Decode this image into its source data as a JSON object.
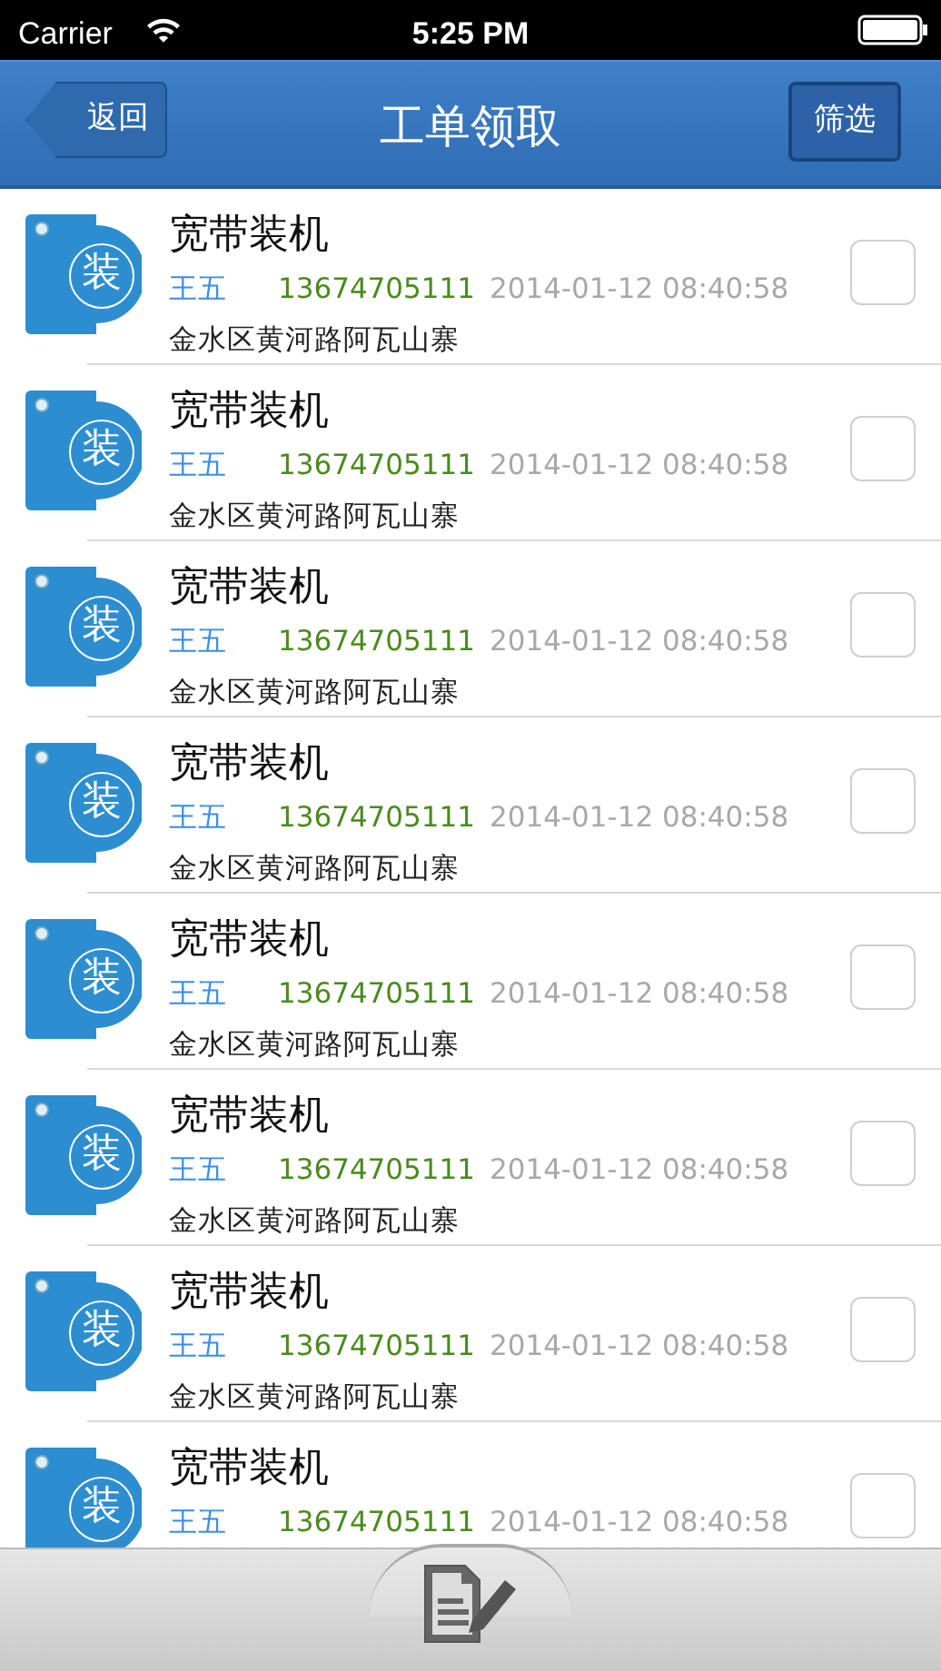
{
  "status_bar": {
    "carrier": "Carrier",
    "time": "5:25 PM"
  },
  "nav": {
    "back": "返回",
    "title": "工单领取",
    "filter": "筛选"
  },
  "orders": [
    {
      "badge": "装",
      "title": "宽带装机",
      "name": "王五",
      "phone": "13674705111",
      "time": "2014-01-12 08:40:58",
      "address": "金水区黄河路阿瓦山寨",
      "checked": false
    },
    {
      "badge": "装",
      "title": "宽带装机",
      "name": "王五",
      "phone": "13674705111",
      "time": "2014-01-12 08:40:58",
      "address": "金水区黄河路阿瓦山寨",
      "checked": false
    },
    {
      "badge": "装",
      "title": "宽带装机",
      "name": "王五",
      "phone": "13674705111",
      "time": "2014-01-12 08:40:58",
      "address": "金水区黄河路阿瓦山寨",
      "checked": false
    },
    {
      "badge": "装",
      "title": "宽带装机",
      "name": "王五",
      "phone": "13674705111",
      "time": "2014-01-12 08:40:58",
      "address": "金水区黄河路阿瓦山寨",
      "checked": false
    },
    {
      "badge": "装",
      "title": "宽带装机",
      "name": "王五",
      "phone": "13674705111",
      "time": "2014-01-12 08:40:58",
      "address": "金水区黄河路阿瓦山寨",
      "checked": false
    },
    {
      "badge": "装",
      "title": "宽带装机",
      "name": "王五",
      "phone": "13674705111",
      "time": "2014-01-12 08:40:58",
      "address": "金水区黄河路阿瓦山寨",
      "checked": false
    },
    {
      "badge": "装",
      "title": "宽带装机",
      "name": "王五",
      "phone": "13674705111",
      "time": "2014-01-12 08:40:58",
      "address": "金水区黄河路阿瓦山寨",
      "checked": false
    },
    {
      "badge": "装",
      "title": "宽带装机",
      "name": "王五",
      "phone": "13674705111",
      "time": "2014-01-12 08:40:58",
      "checked": false
    }
  ]
}
